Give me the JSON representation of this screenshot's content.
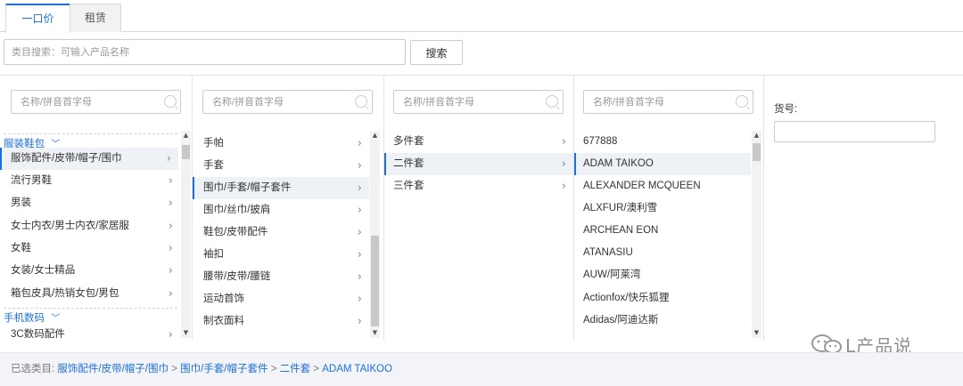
{
  "tabs": [
    {
      "label": "一口价",
      "active": true
    },
    {
      "label": "租赁",
      "active": false
    }
  ],
  "search": {
    "placeholder": "类目搜索：可输入产品名称",
    "button_label": "搜索"
  },
  "columns": {
    "filter_placeholder": "名称/拼音首字母",
    "col1": {
      "groups": [
        {
          "label": "服装鞋包",
          "items": [
            "服饰配件/皮带/帽子/围巾",
            "流行男鞋",
            "男装",
            "女士内衣/男士内衣/家居服",
            "女鞋",
            "女装/女士精品",
            "箱包皮具/热销女包/男包"
          ]
        },
        {
          "label": "手机数码",
          "items": [
            "3C数码配件"
          ]
        }
      ],
      "selected": "服饰配件/皮带/帽子/围巾"
    },
    "col2": {
      "items": [
        "手帕",
        "手套",
        "围巾/手套/帽子套件",
        "围巾/丝巾/披肩",
        "鞋包/皮带配件",
        "袖扣",
        "腰带/皮带/腰链",
        "运动首饰",
        "制衣面料"
      ],
      "selected": "围巾/手套/帽子套件"
    },
    "col3": {
      "items": [
        "多件套",
        "二件套",
        "三件套"
      ],
      "selected": "二件套"
    },
    "col4": {
      "items": [
        "677888",
        "ADAM TAIKOO",
        "ALEXANDER MCQUEEN",
        "ALXFUR/澳利雪",
        "ARCHEAN EON",
        "ATANASIU",
        "AUW/阿莱湾",
        "Actionfox/快乐狐狸",
        "Adidas/阿迪达斯"
      ],
      "selected": "ADAM TAIKOO"
    },
    "col5": {
      "sku_label": "货号:"
    }
  },
  "footer": {
    "prefix": "已选类目:",
    "path": [
      "服饰配件/皮带/帽子/围巾",
      "围巾/手套/帽子套件",
      "二件套",
      "ADAM TAIKOO"
    ],
    "separator": " > "
  },
  "watermark": {
    "text": "L产品说"
  },
  "colors": {
    "accent": "#1e6fd9",
    "selected_bg": "#eef1f5",
    "footer_bg": "#f2f4f7"
  }
}
